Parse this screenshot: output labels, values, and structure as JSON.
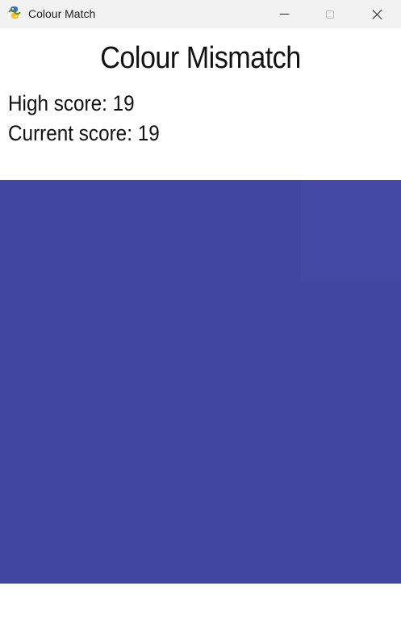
{
  "window": {
    "title": "Colour Match",
    "icon": "python-snake-icon",
    "controls": [
      "minimize-icon",
      "maximize-icon",
      "close-icon"
    ]
  },
  "game": {
    "title": "Colour Mismatch",
    "high_score_label": "High score:",
    "high_score": 19,
    "current_score_label": "Current score:",
    "current_score": 19
  },
  "board": {
    "rows": 4,
    "columns": 4,
    "base_color": "#4146a0",
    "odd_color": "#4549a5",
    "odd_tile_row": 1,
    "odd_tile_column": 4
  }
}
